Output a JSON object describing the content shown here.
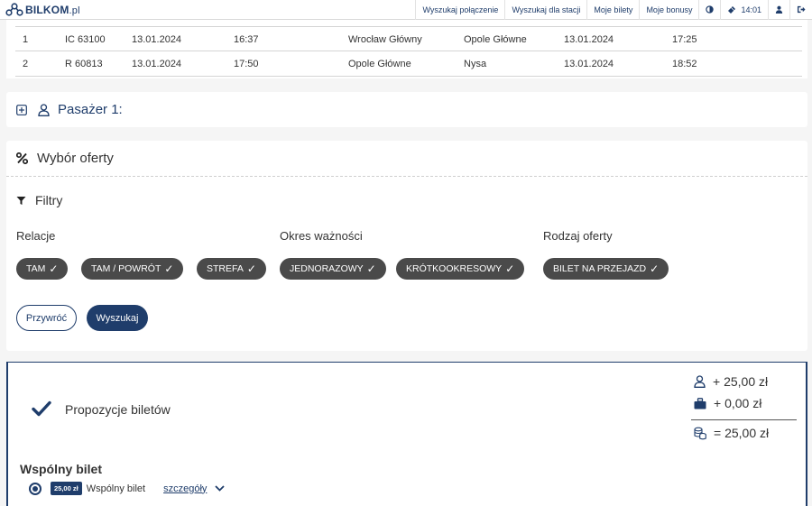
{
  "brand": {
    "name": "BILKOM",
    "suffix": ".pl"
  },
  "nav": {
    "links": [
      "Wyszukaj połączenie",
      "Wyszukaj dla stacji",
      "Moje bilety",
      "Moje bonusy"
    ],
    "time": "14:01"
  },
  "connections": [
    {
      "no": "1",
      "train": "IC 63100",
      "dep_date": "13.01.2024",
      "dep_time": "16:37",
      "from": "Wrocław Główny",
      "to": "Opole Główne",
      "arr_date": "13.01.2024",
      "arr_time": "17:25"
    },
    {
      "no": "2",
      "train": "R 60813",
      "dep_date": "13.01.2024",
      "dep_time": "17:50",
      "from": "Opole Główne",
      "to": "Nysa",
      "arr_date": "13.01.2024",
      "arr_time": "18:52"
    }
  ],
  "passenger": {
    "title": "Pasażer 1:"
  },
  "offer": {
    "title": "Wybór oferty",
    "filters_title": "Filtry",
    "groups": [
      {
        "label": "Relacje",
        "chips": [
          "TAM",
          "TAM / POWRÓT",
          "STREFA"
        ]
      },
      {
        "label": "Okres ważności",
        "chips": [
          "JEDNORAZOWY",
          "KRÓTKOOKRESOWY"
        ]
      },
      {
        "label": "Rodzaj oferty",
        "chips": [
          "BILET NA PRZEJAZD"
        ]
      }
    ],
    "check_glyph": "✓",
    "reset_label": "Przywróć",
    "search_label": "Wyszukaj"
  },
  "proposal": {
    "title": "Propozycje biletów",
    "passenger_price": "+ 25,00 zł",
    "luggage_price": "+ 0,00 zł",
    "total_price": "= 25,00 zł",
    "joint_title": "Wspólny bilet",
    "ticket_badge": "25,00 zł",
    "ticket_name": "Wspólny bilet",
    "details_label": "szczegóły"
  },
  "colors": {
    "brand": "#1f3d6b",
    "chip": "#4a4a4a",
    "background": "#f5f5f5"
  }
}
